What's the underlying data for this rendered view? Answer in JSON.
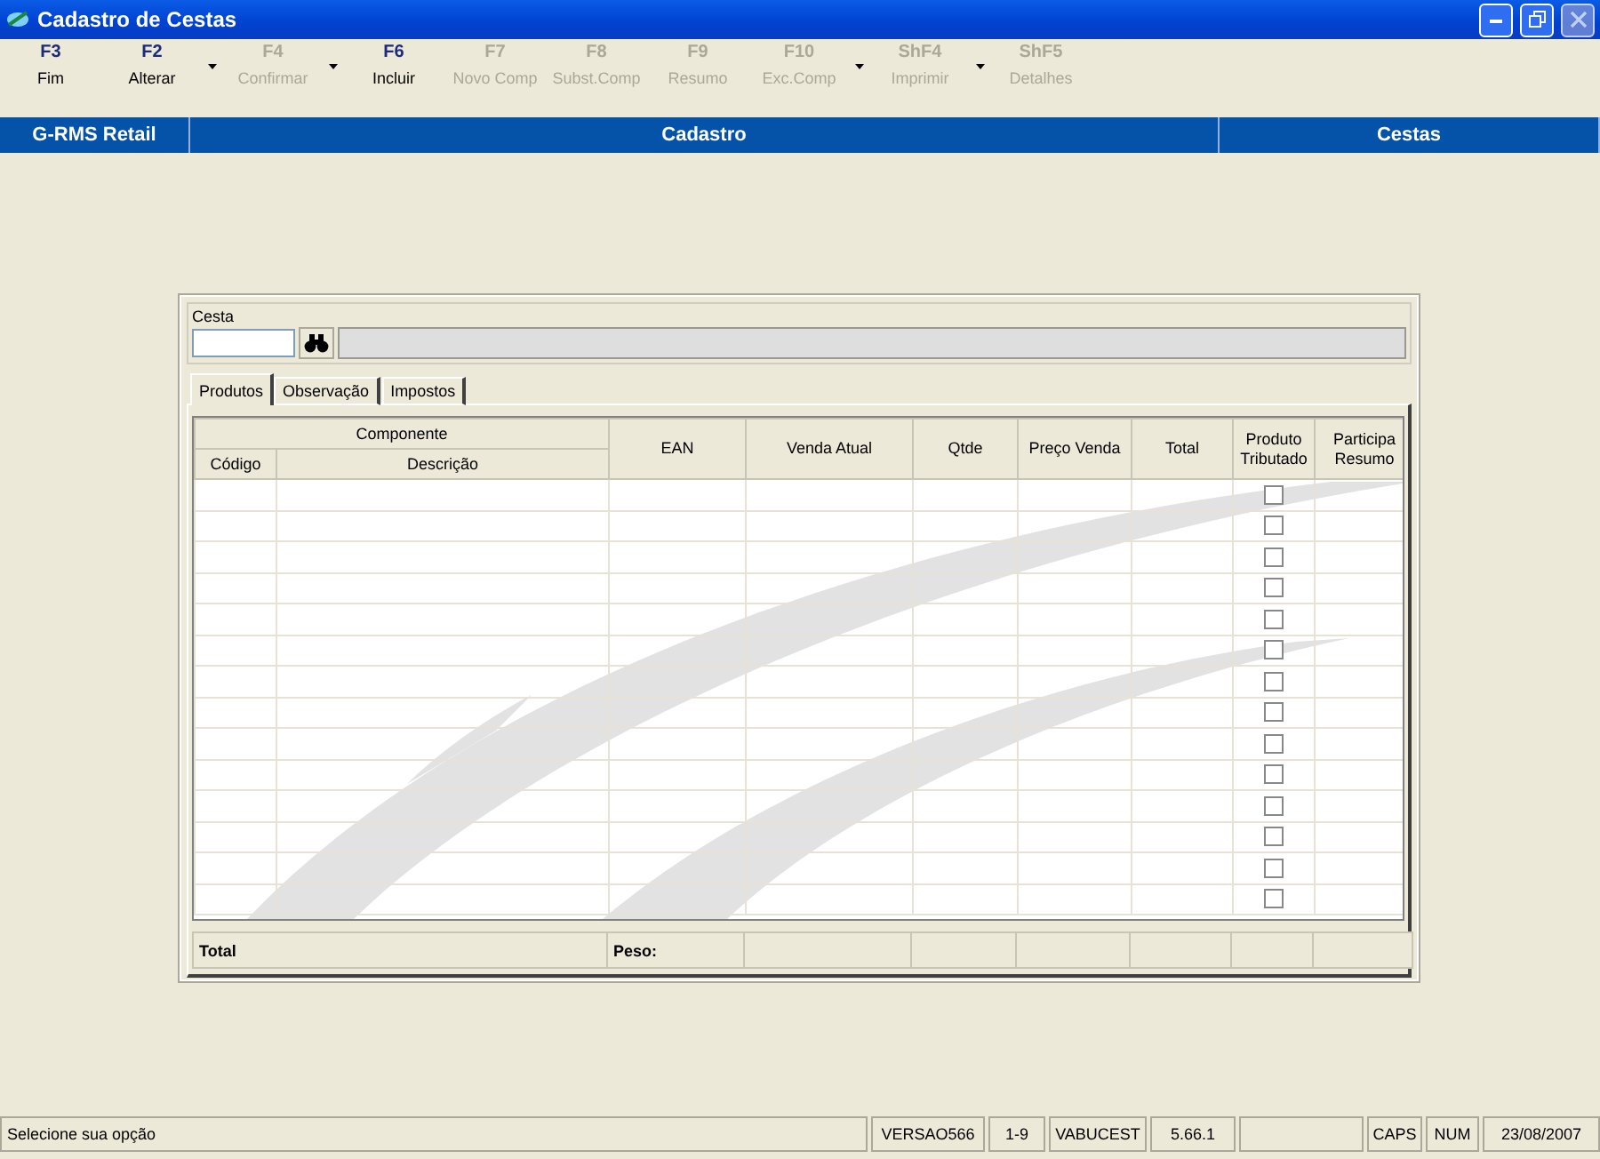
{
  "window": {
    "title": "Cadastro de Cestas",
    "close_disabled": true
  },
  "toolbar": [
    {
      "key": "F3",
      "label": "Fim",
      "enabled": true,
      "has_menu": false
    },
    {
      "key": "F2",
      "label": "Alterar",
      "enabled": true,
      "has_menu": true
    },
    {
      "key": "F4",
      "label": "Confirmar",
      "enabled": false,
      "has_menu": true
    },
    {
      "key": "F6",
      "label": "Incluir",
      "enabled": true,
      "has_menu": false
    },
    {
      "key": "F7",
      "label": "Novo Comp",
      "enabled": false,
      "has_menu": false
    },
    {
      "key": "F8",
      "label": "Subst.Comp",
      "enabled": false,
      "has_menu": false
    },
    {
      "key": "F9",
      "label": "Resumo",
      "enabled": false,
      "has_menu": false
    },
    {
      "key": "F10",
      "label": "Exc.Comp",
      "enabled": false,
      "has_menu": true
    },
    {
      "key": "ShF4",
      "label": "Imprimir",
      "enabled": false,
      "has_menu": true
    },
    {
      "key": "ShF5",
      "label": "Detalhes",
      "enabled": false,
      "has_menu": false
    }
  ],
  "header": [
    "G-RMS Retail",
    "Cadastro",
    "Cestas"
  ],
  "cesta": {
    "label": "Cesta"
  },
  "tabs": [
    {
      "label": "Produtos",
      "selected": true
    },
    {
      "label": "Observação",
      "selected": false
    },
    {
      "label": "Impostos",
      "selected": false
    }
  ],
  "table": {
    "group_header": "Componente",
    "columns": [
      "Código",
      "Descrição",
      "EAN",
      "Venda Atual",
      "Qtde",
      "Preço Venda",
      "Total",
      "Produto Tributado",
      "Participa Resumo"
    ],
    "rows": [
      {
        "tributado": false
      },
      {
        "tributado": false
      },
      {
        "tributado": false
      },
      {
        "tributado": false
      },
      {
        "tributado": false
      },
      {
        "tributado": false
      },
      {
        "tributado": false
      },
      {
        "tributado": false
      },
      {
        "tributado": false
      },
      {
        "tributado": false
      },
      {
        "tributado": false
      },
      {
        "tributado": false
      },
      {
        "tributado": false
      },
      {
        "tributado": false
      }
    ],
    "footer": {
      "total": "Total",
      "peso": "Peso:"
    }
  },
  "status_bar": {
    "message": "Selecione sua opção",
    "fields": [
      {
        "kind": "text",
        "text": "VERSAO566"
      },
      {
        "kind": "text",
        "text": "1-9"
      },
      {
        "kind": "text",
        "text": "VABUCEST"
      },
      {
        "kind": "text",
        "text": "5.66.1"
      },
      {
        "kind": "blank"
      },
      {
        "kind": "text",
        "text": "CAPS"
      },
      {
        "kind": "text",
        "text": "NUM"
      },
      {
        "kind": "text",
        "text": "23/08/2007"
      }
    ]
  }
}
